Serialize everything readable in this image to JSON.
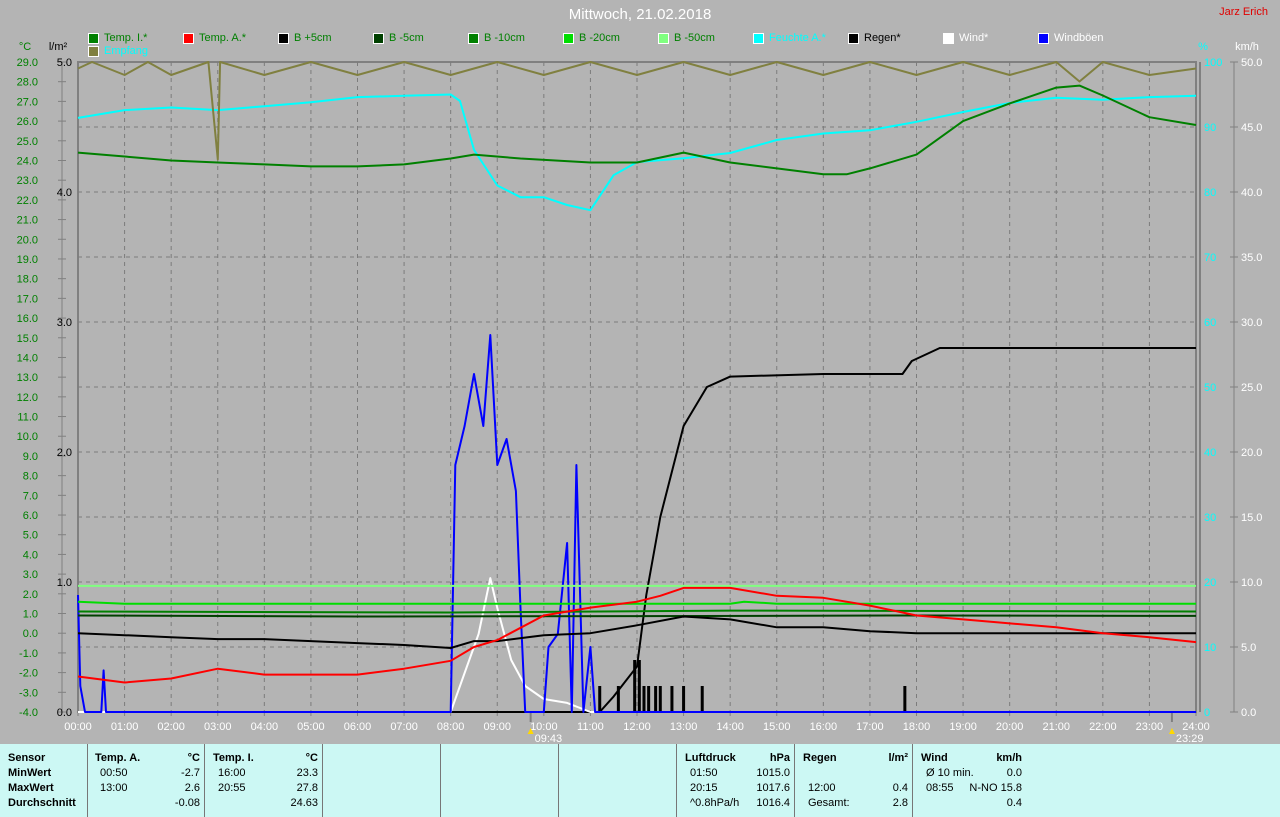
{
  "header": {
    "title": "Mittwoch, 21.02.2018",
    "author": "Jarz Erich"
  },
  "markers": [
    {
      "time": "09:43",
      "icon": "sun-icon"
    },
    {
      "time": "23:29",
      "icon": "moon-icon"
    }
  ],
  "chart_data": {
    "type": "line",
    "title": "Mittwoch, 21.02.2018",
    "x_range_hours": [
      0,
      24
    ],
    "x_ticks": [
      "00:00",
      "01:00",
      "02:00",
      "03:00",
      "04:00",
      "05:00",
      "06:00",
      "07:00",
      "08:00",
      "09:00",
      "10:00",
      "11:00",
      "12:00",
      "13:00",
      "14:00",
      "15:00",
      "16:00",
      "17:00",
      "18:00",
      "19:00",
      "20:00",
      "21:00",
      "22:00",
      "23:00",
      "24:00"
    ],
    "axes": {
      "temp": {
        "label": "°C",
        "range": [
          -4,
          29
        ],
        "ticks": [
          "-4.0",
          "-3.0",
          "-2.0",
          "-1.0",
          "0.0",
          "1.0",
          "2.0",
          "3.0",
          "4.0",
          "5.0",
          "6.0",
          "7.0",
          "8.0",
          "9.0",
          "10.0",
          "11.0",
          "12.0",
          "13.0",
          "14.0",
          "15.0",
          "16.0",
          "17.0",
          "18.0",
          "19.0",
          "20.0",
          "21.0",
          "22.0",
          "23.0",
          "24.0",
          "25.0",
          "26.0",
          "27.0",
          "28.0",
          "29.0"
        ]
      },
      "rain": {
        "label": "l/m²",
        "range": [
          0,
          5
        ],
        "ticks": [
          "0.0",
          "1.0",
          "2.0",
          "3.0",
          "4.0",
          "5.0"
        ]
      },
      "humidity": {
        "label": "%",
        "range": [
          0,
          100
        ],
        "ticks": [
          "0",
          "10",
          "20",
          "30",
          "40",
          "50",
          "60",
          "70",
          "80",
          "90",
          "100"
        ]
      },
      "wind": {
        "label": "km/h",
        "range": [
          0,
          50
        ],
        "ticks": [
          "0.0",
          "5.0",
          "10.0",
          "15.0",
          "20.0",
          "25.0",
          "30.0",
          "35.0",
          "40.0",
          "45.0",
          "50.0"
        ]
      }
    },
    "grid": true,
    "legend_position": "top",
    "series": [
      {
        "name": "Temp. I.*",
        "color": "#008000",
        "label_color": "#008000",
        "axis": "temp",
        "points": [
          [
            0,
            24.4
          ],
          [
            1,
            24.2
          ],
          [
            2,
            24.0
          ],
          [
            3,
            23.9
          ],
          [
            4,
            23.8
          ],
          [
            5,
            23.7
          ],
          [
            6,
            23.7
          ],
          [
            7,
            23.8
          ],
          [
            8,
            24.1
          ],
          [
            8.5,
            24.3
          ],
          [
            9.5,
            24.1
          ],
          [
            11,
            23.9
          ],
          [
            12,
            23.9
          ],
          [
            13,
            24.4
          ],
          [
            14,
            23.9
          ],
          [
            15,
            23.6
          ],
          [
            16,
            23.3
          ],
          [
            16.5,
            23.3
          ],
          [
            17,
            23.6
          ],
          [
            18,
            24.3
          ],
          [
            19,
            26.0
          ],
          [
            20,
            26.9
          ],
          [
            21,
            27.7
          ],
          [
            21.5,
            27.8
          ],
          [
            22,
            27.3
          ],
          [
            23,
            26.2
          ],
          [
            24,
            25.8
          ]
        ]
      },
      {
        "name": "Temp. A.*",
        "color": "#ff0000",
        "label_color": "#008000",
        "axis": "temp",
        "points": [
          [
            0,
            -2.2
          ],
          [
            1,
            -2.5
          ],
          [
            2,
            -2.3
          ],
          [
            3,
            -1.8
          ],
          [
            4,
            -2.1
          ],
          [
            5,
            -2.1
          ],
          [
            6,
            -2.1
          ],
          [
            7,
            -1.8
          ],
          [
            8,
            -1.4
          ],
          [
            8.5,
            -0.7
          ],
          [
            9,
            -0.35
          ],
          [
            10,
            0.9
          ],
          [
            11,
            1.3
          ],
          [
            12,
            1.6
          ],
          [
            12.5,
            1.9
          ],
          [
            13,
            2.3
          ],
          [
            14,
            2.3
          ],
          [
            15,
            1.9
          ],
          [
            16,
            1.8
          ],
          [
            17,
            1.4
          ],
          [
            18,
            0.9
          ],
          [
            19,
            0.7
          ],
          [
            20,
            0.5
          ],
          [
            21,
            0.3
          ],
          [
            22,
            0.0
          ],
          [
            23,
            -0.2
          ],
          [
            24,
            -0.45
          ]
        ]
      },
      {
        "name": "B +5cm",
        "color": "#000000",
        "label_color": "#008000",
        "axis": "temp",
        "points": [
          [
            0,
            0.0
          ],
          [
            1,
            -0.1
          ],
          [
            2,
            -0.2
          ],
          [
            3,
            -0.3
          ],
          [
            4,
            -0.3
          ],
          [
            5,
            -0.4
          ],
          [
            6,
            -0.5
          ],
          [
            7,
            -0.6
          ],
          [
            8,
            -0.75
          ],
          [
            8.5,
            -0.4
          ],
          [
            9,
            -0.4
          ],
          [
            10,
            -0.1
          ],
          [
            11,
            0.0
          ],
          [
            12,
            0.4
          ],
          [
            13,
            0.85
          ],
          [
            14,
            0.7
          ],
          [
            15,
            0.3
          ],
          [
            16,
            0.3
          ],
          [
            17,
            0.1
          ],
          [
            18,
            0.0
          ],
          [
            20,
            0.0
          ],
          [
            22,
            0.0
          ],
          [
            24,
            0.0
          ]
        ]
      },
      {
        "name": "B -5cm",
        "color": "#004000",
        "label_color": "#008000",
        "axis": "temp",
        "points": [
          [
            0,
            0.9
          ],
          [
            6,
            0.85
          ],
          [
            12,
            0.87
          ],
          [
            18,
            0.9
          ],
          [
            24,
            0.88
          ]
        ]
      },
      {
        "name": "B -10cm",
        "color": "#008000",
        "label_color": "#008000",
        "axis": "temp",
        "points": [
          [
            0,
            1.1
          ],
          [
            8,
            1.05
          ],
          [
            14,
            1.15
          ],
          [
            24,
            1.1
          ]
        ]
      },
      {
        "name": "B -20cm",
        "color": "#00dd00",
        "label_color": "#008000",
        "axis": "temp",
        "points": [
          [
            0,
            1.6
          ],
          [
            1,
            1.5
          ],
          [
            8,
            1.5
          ],
          [
            14,
            1.5
          ],
          [
            14.3,
            1.6
          ],
          [
            15,
            1.5
          ],
          [
            24,
            1.5
          ]
        ]
      },
      {
        "name": "B -50cm",
        "color": "#80ff80",
        "label_color": "#008000",
        "axis": "temp",
        "points": [
          [
            0,
            2.4
          ],
          [
            24,
            2.4
          ]
        ]
      },
      {
        "name": "Feuchte A.*",
        "color": "#00ffff",
        "label_color": "#00ffff",
        "axis": "humidity",
        "points": [
          [
            0,
            91.4
          ],
          [
            1,
            92.6
          ],
          [
            2,
            93.0
          ],
          [
            3,
            92.6
          ],
          [
            4,
            93.2
          ],
          [
            5,
            93.8
          ],
          [
            6,
            94.6
          ],
          [
            7,
            94.8
          ],
          [
            8,
            95.0
          ],
          [
            8.2,
            94.0
          ],
          [
            8.5,
            86.5
          ],
          [
            9,
            81.0
          ],
          [
            9.5,
            79.2
          ],
          [
            10,
            79.2
          ],
          [
            10.5,
            78.0
          ],
          [
            11,
            77.2
          ],
          [
            11.5,
            82.6
          ],
          [
            12,
            84.6
          ],
          [
            13,
            85.2
          ],
          [
            14,
            86.0
          ],
          [
            15,
            88.0
          ],
          [
            16,
            89.0
          ],
          [
            17,
            89.5
          ],
          [
            18,
            90.8
          ],
          [
            19,
            92.3
          ],
          [
            20,
            93.7
          ],
          [
            21,
            94.5
          ],
          [
            22,
            94.2
          ],
          [
            23,
            94.6
          ],
          [
            24,
            94.8
          ]
        ]
      },
      {
        "name": "Empfang",
        "color": "#808040",
        "label_color": "#00ffff",
        "axis": "humidity",
        "points": [
          [
            0,
            99
          ],
          [
            0.3,
            100
          ],
          [
            1,
            98
          ],
          [
            1.5,
            100
          ],
          [
            2,
            98
          ],
          [
            2.8,
            100
          ],
          [
            3,
            85
          ],
          [
            3.05,
            100
          ],
          [
            4,
            98
          ],
          [
            5,
            100
          ],
          [
            6,
            98
          ],
          [
            7,
            100
          ],
          [
            8,
            98
          ],
          [
            9,
            100
          ],
          [
            10,
            98
          ],
          [
            11,
            100
          ],
          [
            12,
            98
          ],
          [
            13,
            100
          ],
          [
            14,
            98
          ],
          [
            15,
            100
          ],
          [
            16,
            98
          ],
          [
            17,
            100
          ],
          [
            18,
            98
          ],
          [
            19,
            100
          ],
          [
            20,
            98
          ],
          [
            21,
            100
          ],
          [
            21.5,
            97
          ],
          [
            22,
            100
          ],
          [
            23,
            98
          ],
          [
            24,
            99
          ]
        ]
      },
      {
        "name": "Regen*",
        "color": "#000000",
        "label_color": "#000000",
        "axis": "rain",
        "points": [
          [
            0,
            0
          ],
          [
            11.2,
            0
          ],
          [
            11.5,
            0.12
          ],
          [
            12,
            0.35
          ],
          [
            12.2,
            0.9
          ],
          [
            12.5,
            1.5
          ],
          [
            13,
            2.2
          ],
          [
            13.5,
            2.5
          ],
          [
            14,
            2.58
          ],
          [
            16,
            2.6
          ],
          [
            17.7,
            2.6
          ],
          [
            17.9,
            2.7
          ],
          [
            18.5,
            2.8
          ],
          [
            24,
            2.8
          ]
        ]
      },
      {
        "name": "Wind*",
        "color": "#ffffff",
        "label_color": "#ffffff",
        "axis": "wind",
        "points": [
          [
            0,
            0
          ],
          [
            8.0,
            0
          ],
          [
            8.3,
            3
          ],
          [
            8.6,
            6
          ],
          [
            8.85,
            10.3
          ],
          [
            9.0,
            8
          ],
          [
            9.3,
            4
          ],
          [
            9.6,
            2
          ],
          [
            10,
            1
          ],
          [
            10.5,
            0.7
          ],
          [
            11,
            0
          ],
          [
            24,
            0
          ]
        ]
      },
      {
        "name": "Windböen",
        "color": "#0000ff",
        "label_color": "#ffffff",
        "axis": "wind",
        "points": [
          [
            0,
            9
          ],
          [
            0.05,
            2
          ],
          [
            0.15,
            0
          ],
          [
            0.5,
            0
          ],
          [
            0.55,
            3.2
          ],
          [
            0.6,
            0
          ],
          [
            8.0,
            0
          ],
          [
            8.1,
            19
          ],
          [
            8.3,
            22
          ],
          [
            8.5,
            26
          ],
          [
            8.7,
            22
          ],
          [
            8.85,
            29
          ],
          [
            9.0,
            19
          ],
          [
            9.2,
            21
          ],
          [
            9.4,
            17
          ],
          [
            9.5,
            8
          ],
          [
            9.6,
            0
          ],
          [
            10,
            0
          ],
          [
            10.1,
            5
          ],
          [
            10.3,
            6
          ],
          [
            10.5,
            13
          ],
          [
            10.6,
            0
          ],
          [
            10.7,
            19
          ],
          [
            10.85,
            0
          ],
          [
            11,
            5
          ],
          [
            11.1,
            0
          ],
          [
            24,
            0
          ]
        ]
      }
    ],
    "rain_bars": {
      "axis": "rain",
      "color": "#000000",
      "points": [
        [
          11.2,
          0.2
        ],
        [
          11.6,
          0.2
        ],
        [
          11.95,
          0.4
        ],
        [
          12.05,
          0.4
        ],
        [
          12.15,
          0.2
        ],
        [
          12.25,
          0.2
        ],
        [
          12.4,
          0.2
        ],
        [
          12.5,
          0.2
        ],
        [
          12.75,
          0.2
        ],
        [
          13.0,
          0.2
        ],
        [
          13.4,
          0.2
        ],
        [
          17.75,
          0.2
        ]
      ]
    }
  },
  "stats": {
    "sensor": {
      "header": "Sensor",
      "rows": [
        "MinWert",
        "MaxWert",
        "Durchschnitt"
      ]
    },
    "temp_a": {
      "header": "Temp. A.",
      "unit": "°C",
      "rows": [
        [
          "00:50",
          "-2.7"
        ],
        [
          "13:00",
          "2.6"
        ],
        [
          "",
          "-0.08"
        ]
      ]
    },
    "temp_i": {
      "header": "Temp. I.",
      "unit": "°C",
      "rows": [
        [
          "16:00",
          "23.3"
        ],
        [
          "20:55",
          "27.8"
        ],
        [
          "",
          "24.63"
        ]
      ]
    },
    "pressure": {
      "header": "Luftdruck",
      "unit": "hPa",
      "rows": [
        [
          "01:50",
          "1015.0"
        ],
        [
          "20:15",
          "1017.6"
        ],
        [
          "^0.8hPa/h",
          "1016.4"
        ]
      ]
    },
    "rain": {
      "header": "Regen",
      "unit": "l/m²",
      "rows": [
        [
          "",
          ""
        ],
        [
          "12:00",
          "0.4"
        ],
        [
          "Gesamt:",
          "2.8"
        ]
      ]
    },
    "wind": {
      "header": "Wind",
      "unit": "km/h",
      "rows": [
        [
          "Ø 10 min.",
          "0.0"
        ],
        [
          "08:55",
          "N-NO 15.8"
        ],
        [
          "",
          "0.4"
        ]
      ]
    }
  }
}
